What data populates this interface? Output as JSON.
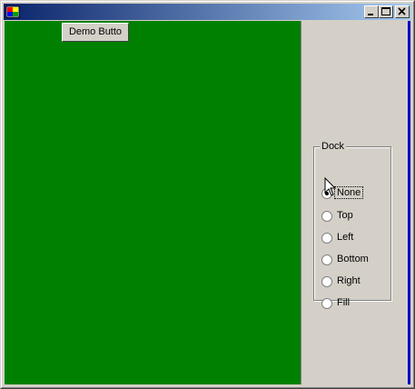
{
  "window": {
    "title": "",
    "icon": "app-window-icon",
    "controls": {
      "minimize": "minimize-icon",
      "maximize": "maximize-icon",
      "close": "close-icon"
    }
  },
  "panel": {
    "background": "#008000",
    "demo_button_label": "Demo Butto"
  },
  "dock_group": {
    "caption": "Dock",
    "options": [
      {
        "label": "None",
        "checked": true
      },
      {
        "label": "Top",
        "checked": false
      },
      {
        "label": "Left",
        "checked": false
      },
      {
        "label": "Bottom",
        "checked": false
      },
      {
        "label": "Right",
        "checked": false
      },
      {
        "label": "Fill",
        "checked": false
      }
    ]
  }
}
